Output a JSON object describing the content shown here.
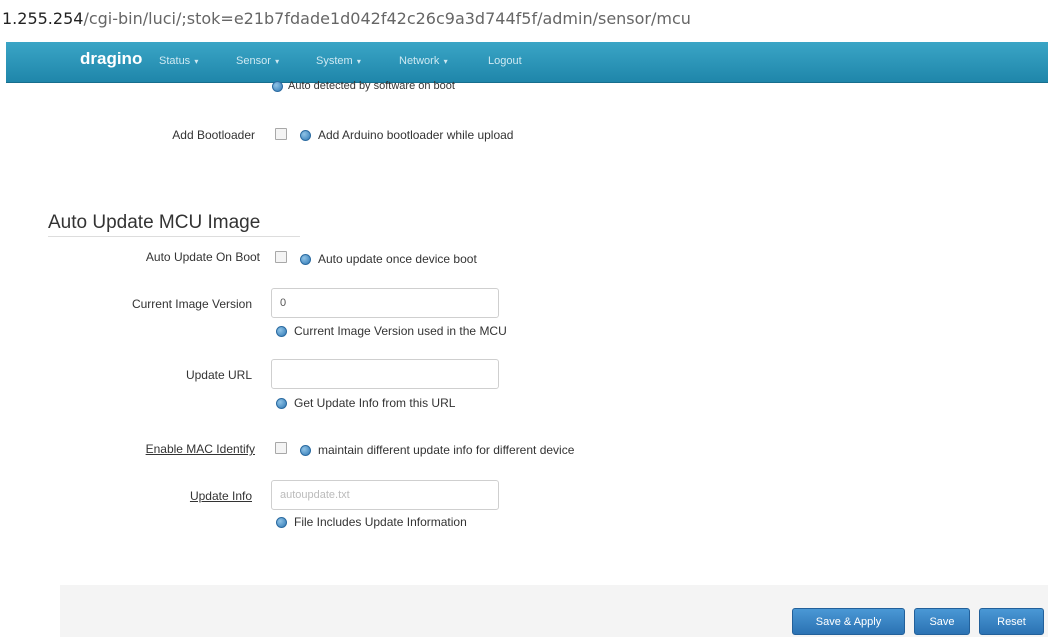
{
  "browser": {
    "url_host": "1.255.254",
    "url_path": "/cgi-bin/luci/;stok=e21b7fdade1d042f42c26c9a3d744f5f/admin/sensor/mcu"
  },
  "navbar": {
    "brand": "dragino",
    "items": [
      {
        "label": "Status"
      },
      {
        "label": "Sensor"
      },
      {
        "label": "System"
      },
      {
        "label": "Network"
      },
      {
        "label": "Logout"
      }
    ]
  },
  "partial_hint": "Auto detected by software on boot",
  "bootloader": {
    "label": "Add Bootloader",
    "hint": "Add Arduino bootloader while upload"
  },
  "section": {
    "title": "Auto Update MCU Image"
  },
  "auto_update": {
    "label": "Auto Update On Boot",
    "hint": "Auto update once device boot"
  },
  "image_version": {
    "label": "Current Image Version",
    "value": "0",
    "hint": "Current Image Version used in the MCU"
  },
  "update_url": {
    "label": "Update URL",
    "value": "",
    "hint": "Get Update Info from this URL"
  },
  "mac_identify": {
    "label": "Enable MAC Identify",
    "hint": "maintain different update info for different device"
  },
  "update_info": {
    "label": "Update Info",
    "placeholder": "autoupdate.txt",
    "hint": "File Includes Update Information"
  },
  "footer": {
    "save_apply": "Save & Apply",
    "save": "Save",
    "reset": "Reset"
  }
}
